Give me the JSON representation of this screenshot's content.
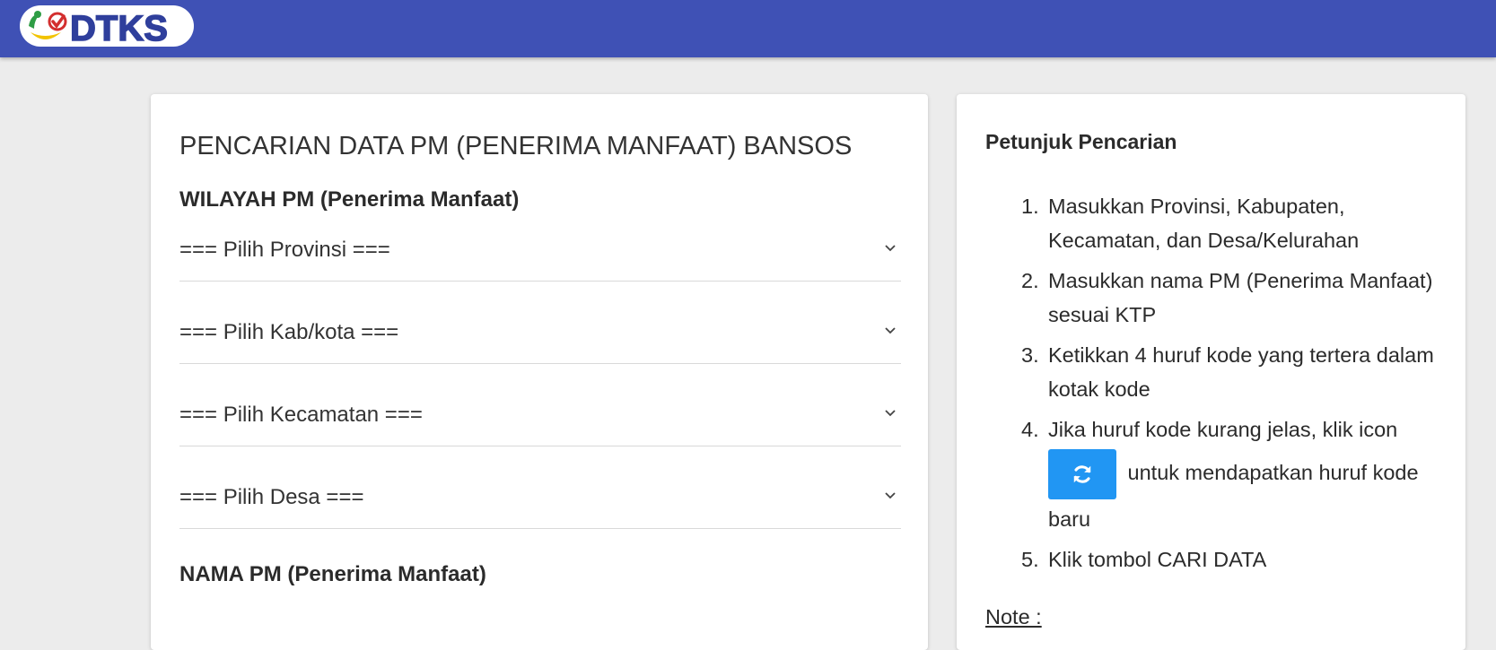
{
  "header": {
    "logo_text": "DTKS",
    "brand_color": "#3f51b5"
  },
  "search_form": {
    "title": "PENCARIAN DATA PM (PENERIMA MANFAAT) BANSOS",
    "region_label": "WILAYAH PM (Penerima Manfaat)",
    "province_select": "=== Pilih Provinsi ===",
    "regency_select": "=== Pilih Kab/kota ===",
    "district_select": "=== Pilih Kecamatan ===",
    "village_select": "=== Pilih Desa ===",
    "name_label": "NAMA PM (Penerima Manfaat)"
  },
  "instructions": {
    "title": "Petunjuk Pencarian",
    "steps": [
      {
        "num": "1.",
        "text": "Masukkan Provinsi, Kabupaten, Kecamatan, dan Desa/Kelurahan"
      },
      {
        "num": "2.",
        "text": "Masukkan nama PM (Penerima Manfaat) sesuai KTP"
      },
      {
        "num": "3.",
        "text": "Ketikkan 4 huruf kode yang tertera dalam kotak kode"
      },
      {
        "num": "4.",
        "text_before": "Jika huruf kode kurang jelas, klik icon",
        "text_after": "untuk mendapatkan huruf kode baru"
      },
      {
        "num": "5.",
        "text": "Klik tombol CARI DATA"
      }
    ],
    "refresh_icon": "refresh-icon",
    "refresh_color": "#2196f3",
    "note_label": "Note :"
  }
}
